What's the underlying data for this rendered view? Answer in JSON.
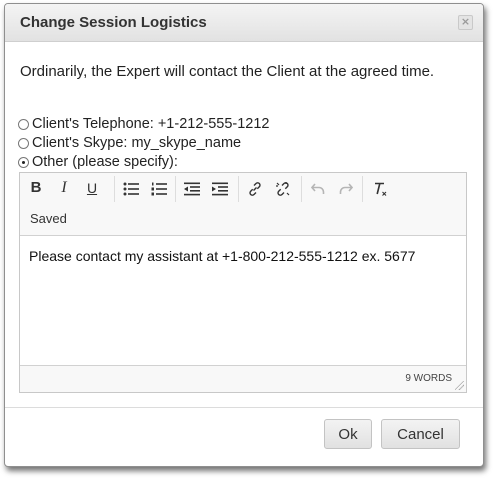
{
  "dialog": {
    "title": "Change Session Logistics",
    "close_label": "×"
  },
  "intro_text": "Ordinarily, the Expert will contact the Client at the agreed time.",
  "options": [
    {
      "label": "Client's Telephone: +1-212-555-1212",
      "checked": false
    },
    {
      "label": "Client's Skype: my_skype_name",
      "checked": false
    },
    {
      "label": "Other (please specify):",
      "checked": true
    }
  ],
  "editor": {
    "toolbar": {
      "bold_label": "B",
      "italic_label": "I",
      "underline_label": "U",
      "icons": [
        "bold-icon",
        "italic-icon",
        "underline-icon",
        "bulleted-list-icon",
        "numbered-list-icon",
        "decrease-indent-icon",
        "increase-indent-icon",
        "link-icon",
        "unlink-icon",
        "undo-icon",
        "redo-icon",
        "remove-format-icon"
      ]
    },
    "status_text": "Saved",
    "content": "Please contact my assistant at +1-800-212-555-1212 ex. 5677",
    "word_count": "9 WORDS"
  },
  "buttons": {
    "ok_label": "Ok",
    "cancel_label": "Cancel"
  }
}
